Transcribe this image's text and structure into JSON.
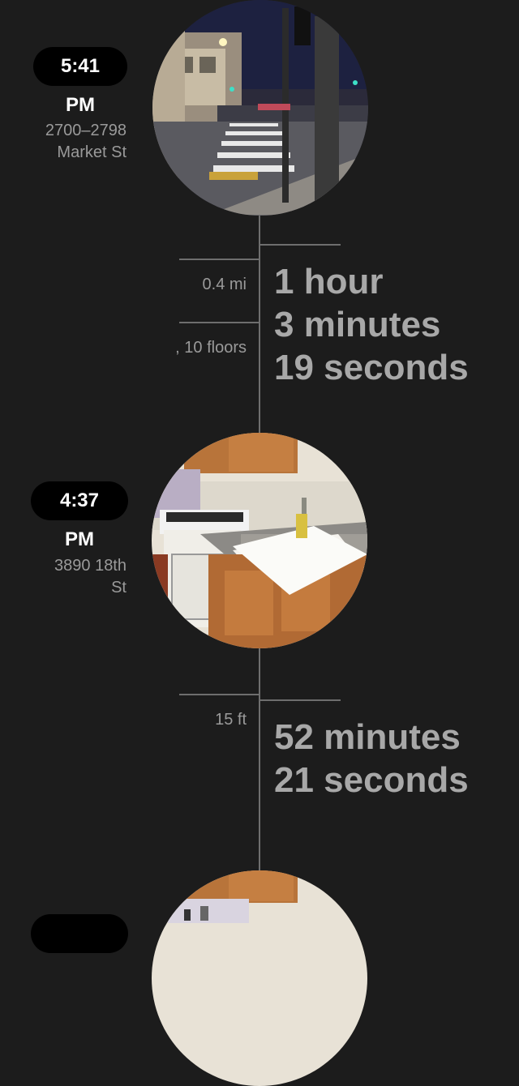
{
  "timeline": {
    "entries": [
      {
        "time": "5:41 PM",
        "address_line1": "2700–2798",
        "address_line2": "Market St",
        "photo": "street-crosswalk-night-photo"
      },
      {
        "time": "4:37 PM",
        "address_line1": "3890 18th",
        "address_line2": "St",
        "photo": "kitchen-photo"
      },
      {
        "photo": "kitchen-photo-partial"
      }
    ],
    "segments": [
      {
        "distance": "0.4 mi",
        "floors": ", 10 floors",
        "duration_line1": "1 hour",
        "duration_line2": "3 minutes",
        "duration_line3": "19 seconds"
      },
      {
        "distance": "15 ft",
        "duration_line1": "52 minutes",
        "duration_line2": "21 seconds"
      }
    ]
  },
  "colors": {
    "background": "#1c1c1c",
    "line": "#6e6e6e",
    "pill": "#000000",
    "pill_text": "#ffffff",
    "duration_text": "#a8a8a8"
  }
}
